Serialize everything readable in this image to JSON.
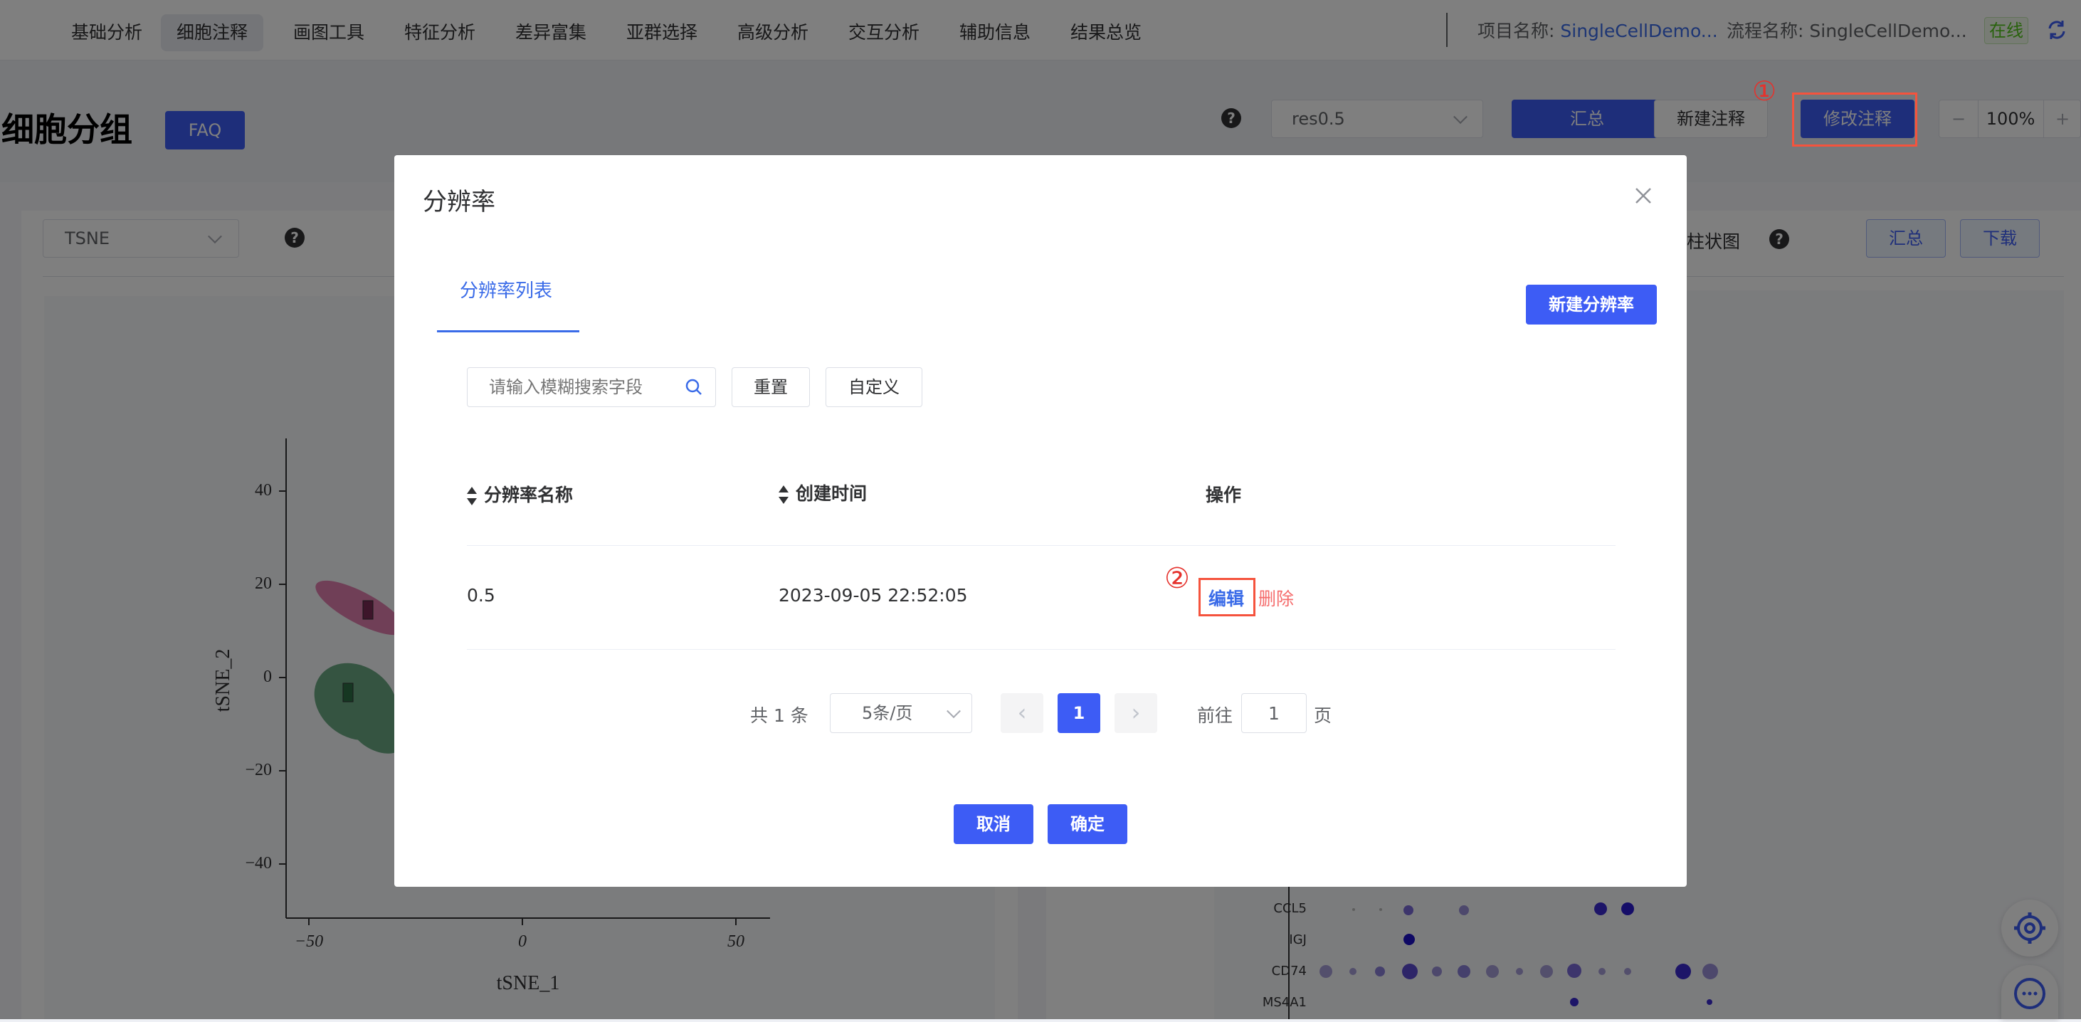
{
  "nav": {
    "items": [
      "基础分析",
      "细胞注释",
      "画图工具",
      "特征分析",
      "差异富集",
      "亚群选择",
      "高级分析",
      "交互分析",
      "辅助信息",
      "结果总览"
    ],
    "active_index": 1
  },
  "project": {
    "label": "项目名称: ",
    "value": "SingleCellDemo..."
  },
  "flow": {
    "label": "流程名称: ",
    "value": "SingleCellDemo..."
  },
  "status": "在线",
  "page": {
    "title": "细胞分组",
    "faq": "FAQ",
    "res_select": "res0.5",
    "summary": "汇总",
    "new_annotation": "新建注释",
    "modify_annotation": "修改注释",
    "zoom": "100%",
    "zoom_minus": "−",
    "zoom_plus": "+"
  },
  "left_panel": {
    "reduction_select": "TSNE",
    "xlabel": "tSNE_1",
    "ylabel": "tSNE_2",
    "yticks": [
      "40",
      "20",
      "0",
      "−20",
      "−40"
    ],
    "xticks": [
      "−50",
      "0",
      "50"
    ]
  },
  "right_panel": {
    "chart_type": "柱状图",
    "summary": "汇总",
    "download": "下载",
    "genes": [
      "CCL5",
      "IGJ",
      "CD74",
      "MS4A1"
    ]
  },
  "dialog": {
    "title": "分辨率",
    "tab": "分辨率列表",
    "new_button": "新建分辨率",
    "search_placeholder": "请输入模糊搜索字段",
    "reset": "重置",
    "custom": "自定义",
    "columns": [
      "分辨率名称",
      "创建时间",
      "操作"
    ],
    "rows": [
      {
        "name": "0.5",
        "created": "2023-09-05 22:52:05",
        "edit": "编辑",
        "delete": "删除"
      }
    ],
    "pagination": {
      "total": "共 1 条",
      "page_size": "5条/页",
      "current": "1",
      "goto_label": "前往",
      "goto_value": "1",
      "page_suffix": "页",
      "prev": "‹",
      "next": "›"
    },
    "cancel": "取消",
    "confirm": "确定"
  },
  "annotations": {
    "step1": "①",
    "step2": "②"
  },
  "colors": {
    "primary": "#3d5cf5",
    "danger": "#f5533d",
    "delete_text": "#f56c6c",
    "link": "#3a6be8"
  },
  "icons": {
    "refresh": "refresh-icon",
    "settings": "gear-icon",
    "chat": "chat-icon",
    "search": "search-icon",
    "close": "close-icon"
  }
}
